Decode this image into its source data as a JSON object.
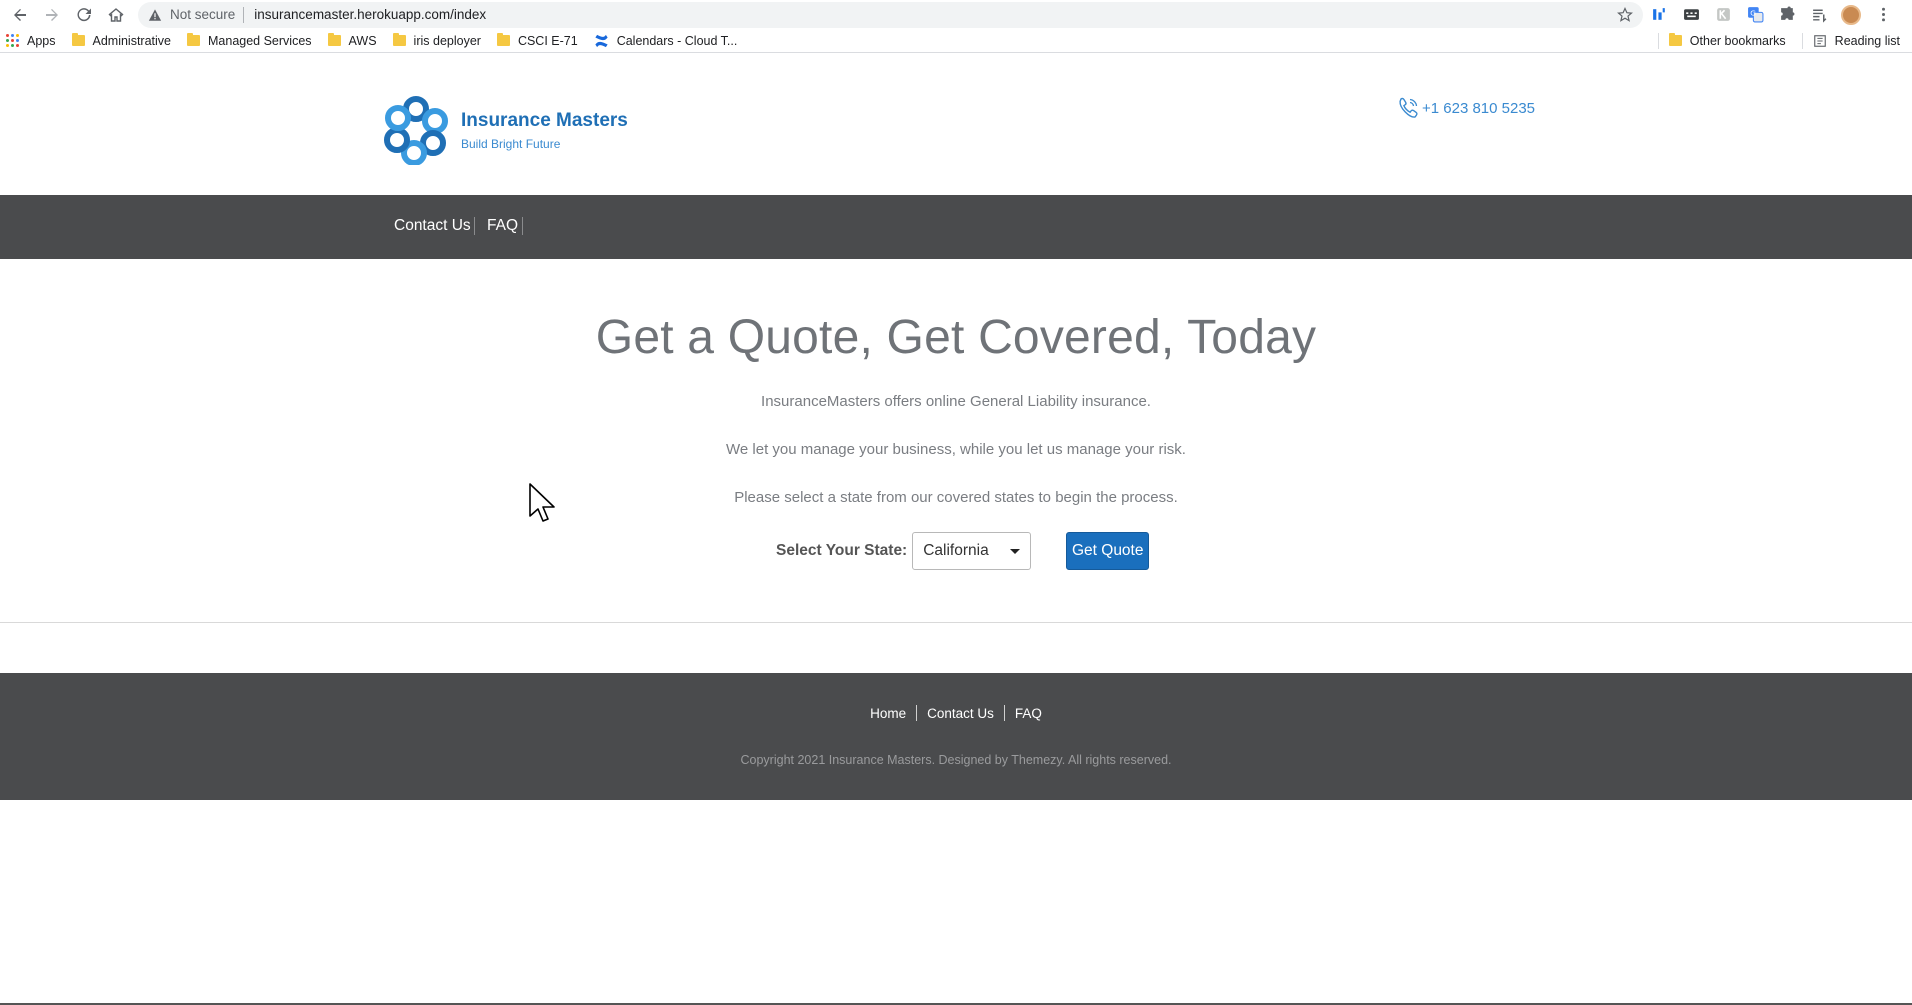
{
  "browser": {
    "security_label": "Not secure",
    "url": "insurancemaster.herokuapp.com/index",
    "bookmarks": [
      {
        "label": "Apps",
        "icon": "apps-grid-icon"
      },
      {
        "label": "Administrative",
        "icon": "folder-icon"
      },
      {
        "label": "Managed Services",
        "icon": "folder-icon"
      },
      {
        "label": "AWS",
        "icon": "folder-icon"
      },
      {
        "label": "iris deployer",
        "icon": "folder-icon"
      },
      {
        "label": "CSCI E-71",
        "icon": "folder-icon"
      },
      {
        "label": "Calendars - Cloud T...",
        "icon": "confluence-icon"
      }
    ],
    "other_bookmarks": "Other bookmarks",
    "reading_list": "Reading list"
  },
  "header": {
    "brand_name": "Insurance Masters",
    "tagline": "Build Bright Future",
    "phone": "+1 623 810 5235"
  },
  "nav": {
    "items": [
      "Contact Us",
      "FAQ"
    ]
  },
  "hero": {
    "title": "Get a Quote, Get Covered, Today",
    "line1": "InsuranceMasters offers online General Liability insurance.",
    "line2": "We let you manage your business, while you let us manage your risk.",
    "line3": "Please select a state from our covered states to begin the process.",
    "state_label": "Select Your State:",
    "selected_state": "California",
    "button": "Get Quote"
  },
  "footer": {
    "links": [
      "Home",
      "Contact Us",
      "FAQ"
    ],
    "copyright": "Copyright 2021 Insurance Masters. Designed by Themezy. All rights reserved."
  },
  "colors": {
    "brand_blue": "#1f6fb5",
    "nav_bg": "#4a4b4d",
    "button_blue": "#1a6fbd"
  }
}
